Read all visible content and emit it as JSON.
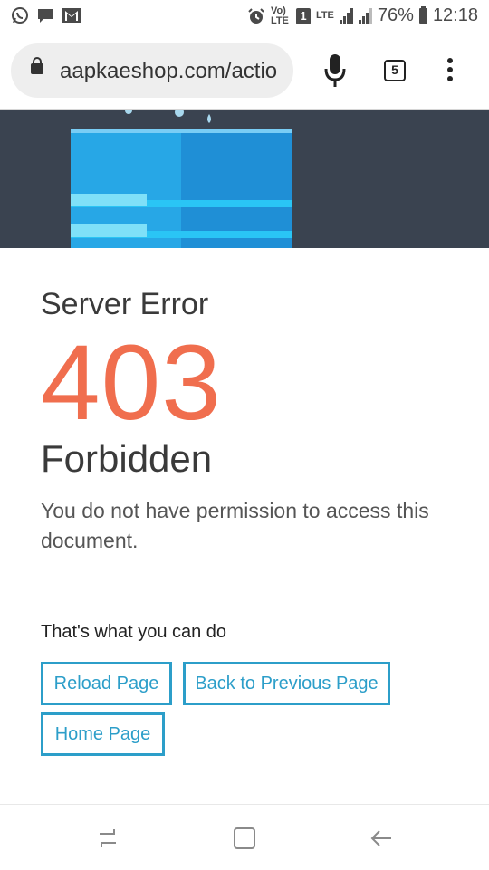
{
  "status_bar": {
    "signal_badge": "1",
    "network_label": "LTE",
    "volte_label": "Vo) LTE",
    "battery": "76%",
    "time": "12:18"
  },
  "browser": {
    "url": "aapkaeshop.com/actio",
    "tab_count": "5"
  },
  "error": {
    "eyebrow": "Server Error",
    "code": "403",
    "title": "Forbidden",
    "message": "You do not have permission to access this document."
  },
  "actions": {
    "heading": "That's what you can do",
    "reload": "Reload Page",
    "back": "Back to Previous Page",
    "home": "Home Page"
  },
  "colors": {
    "accent": "#2c9ec9",
    "error_code": "#f06e4e",
    "hero_bg": "#3a4350"
  }
}
